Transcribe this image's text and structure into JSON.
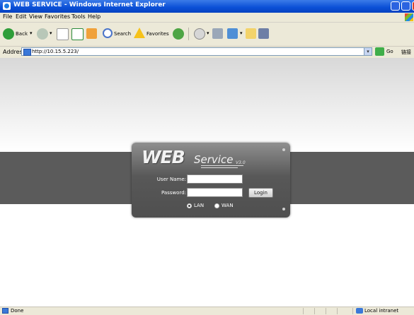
{
  "window": {
    "title": "WEB SERVICE - Windows Internet Explorer"
  },
  "menu": {
    "items": [
      "File",
      "Edit",
      "View",
      "Favorites",
      "Tools",
      "Help"
    ]
  },
  "toolbar": {
    "back_label": "Back",
    "search_label": "Search",
    "favorites_label": "Favorites"
  },
  "address": {
    "label": "Address",
    "value": "http://10.15.5.223/",
    "go_label": "Go",
    "links_label": "链接"
  },
  "login": {
    "logo_main": "WEB",
    "logo_service": "Service",
    "logo_version": "V3.0",
    "username_label": "User Name:",
    "username_value": "",
    "password_label": "Password:",
    "password_value": "",
    "login_button": "Login",
    "options": [
      {
        "label": "LAN",
        "selected": true
      },
      {
        "label": "WAN",
        "selected": false
      }
    ]
  },
  "status": {
    "text": "Done",
    "zone": "Local intranet"
  }
}
